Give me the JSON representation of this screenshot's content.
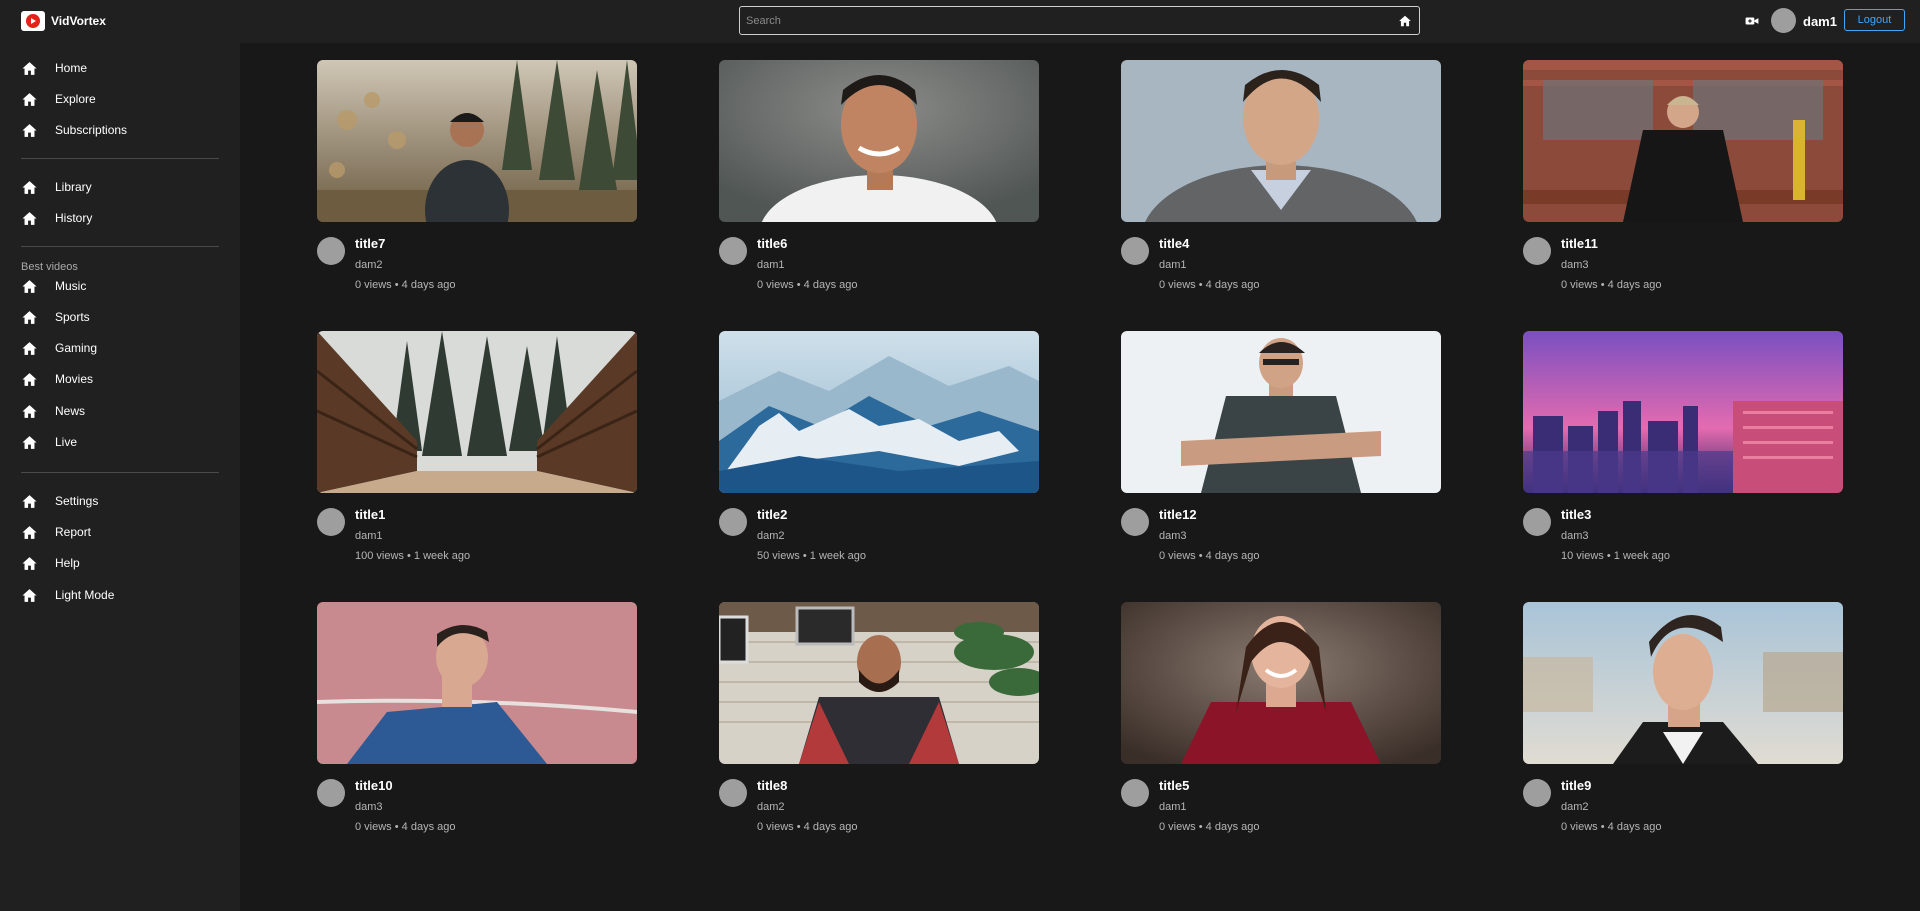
{
  "app": {
    "name": "VidVortex"
  },
  "search": {
    "placeholder": "Search"
  },
  "user": {
    "name": "dam1",
    "logout_label": "Logout"
  },
  "sidebar": {
    "group1": [
      {
        "label": "Home",
        "icon": "home-icon"
      },
      {
        "label": "Explore",
        "icon": "home-icon"
      },
      {
        "label": "Subscriptions",
        "icon": "home-icon"
      }
    ],
    "group2": [
      {
        "label": "Library",
        "icon": "home-icon"
      },
      {
        "label": "History",
        "icon": "home-icon"
      }
    ],
    "best_title": "Best videos",
    "group3": [
      {
        "label": "Music",
        "icon": "home-icon"
      },
      {
        "label": "Sports",
        "icon": "home-icon"
      },
      {
        "label": "Gaming",
        "icon": "home-icon"
      },
      {
        "label": "Movies",
        "icon": "home-icon"
      },
      {
        "label": "News",
        "icon": "home-icon"
      },
      {
        "label": "Live",
        "icon": "home-icon"
      }
    ],
    "group4": [
      {
        "label": "Settings",
        "icon": "home-icon"
      },
      {
        "label": "Report",
        "icon": "home-icon"
      },
      {
        "label": "Help",
        "icon": "home-icon"
      },
      {
        "label": "Light Mode",
        "icon": "home-icon"
      }
    ]
  },
  "videos": [
    {
      "title": "title7",
      "channel": "dam2",
      "views": "0 views",
      "age": "4 days ago"
    },
    {
      "title": "title6",
      "channel": "dam1",
      "views": "0 views",
      "age": "4 days ago"
    },
    {
      "title": "title4",
      "channel": "dam1",
      "views": "0 views",
      "age": "4 days ago"
    },
    {
      "title": "title11",
      "channel": "dam3",
      "views": "0 views",
      "age": "4 days ago"
    },
    {
      "title": "title1",
      "channel": "dam1",
      "views": "100 views",
      "age": "1 week ago"
    },
    {
      "title": "title2",
      "channel": "dam2",
      "views": "50 views",
      "age": "1 week ago"
    },
    {
      "title": "title12",
      "channel": "dam3",
      "views": "0 views",
      "age": "4 days ago"
    },
    {
      "title": "title3",
      "channel": "dam3",
      "views": "10 views",
      "age": "1 week ago"
    },
    {
      "title": "title10",
      "channel": "dam3",
      "views": "0 views",
      "age": "4 days ago"
    },
    {
      "title": "title8",
      "channel": "dam2",
      "views": "0 views",
      "age": "4 days ago"
    },
    {
      "title": "title5",
      "channel": "dam1",
      "views": "0 views",
      "age": "4 days ago"
    },
    {
      "title": "title9",
      "channel": "dam2",
      "views": "0 views",
      "age": "4 days ago"
    }
  ],
  "meta_separator": " • "
}
